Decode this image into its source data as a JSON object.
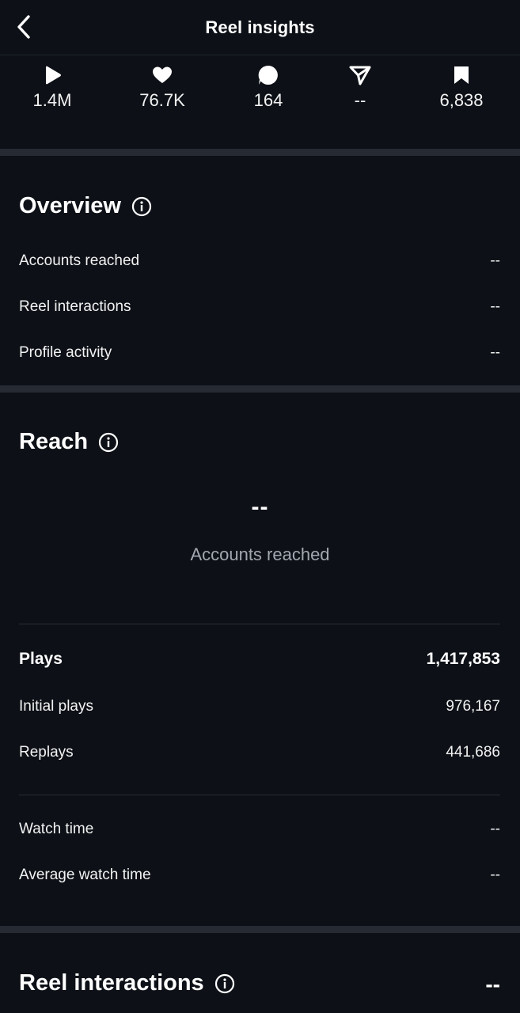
{
  "header": {
    "title": "Reel insights"
  },
  "stats": [
    {
      "icon": "play-icon",
      "value": "1.4M"
    },
    {
      "icon": "heart-icon",
      "value": "76.7K"
    },
    {
      "icon": "comment-icon",
      "value": "164"
    },
    {
      "icon": "share-icon",
      "value": "--"
    },
    {
      "icon": "bookmark-icon",
      "value": "6,838"
    }
  ],
  "overview": {
    "title": "Overview",
    "rows": [
      {
        "label": "Accounts reached",
        "value": "--"
      },
      {
        "label": "Reel interactions",
        "value": "--"
      },
      {
        "label": "Profile activity",
        "value": "--"
      }
    ]
  },
  "reach": {
    "title": "Reach",
    "big_value": "--",
    "big_label": "Accounts reached",
    "plays": {
      "label": "Plays",
      "value": "1,417,853"
    },
    "initial_plays": {
      "label": "Initial plays",
      "value": "976,167"
    },
    "replays": {
      "label": "Replays",
      "value": "441,686"
    },
    "watch_time": {
      "label": "Watch time",
      "value": "--"
    },
    "avg_watch_time": {
      "label": "Average watch time",
      "value": "--"
    }
  },
  "reel_interactions": {
    "title": "Reel interactions",
    "value": "--"
  }
}
